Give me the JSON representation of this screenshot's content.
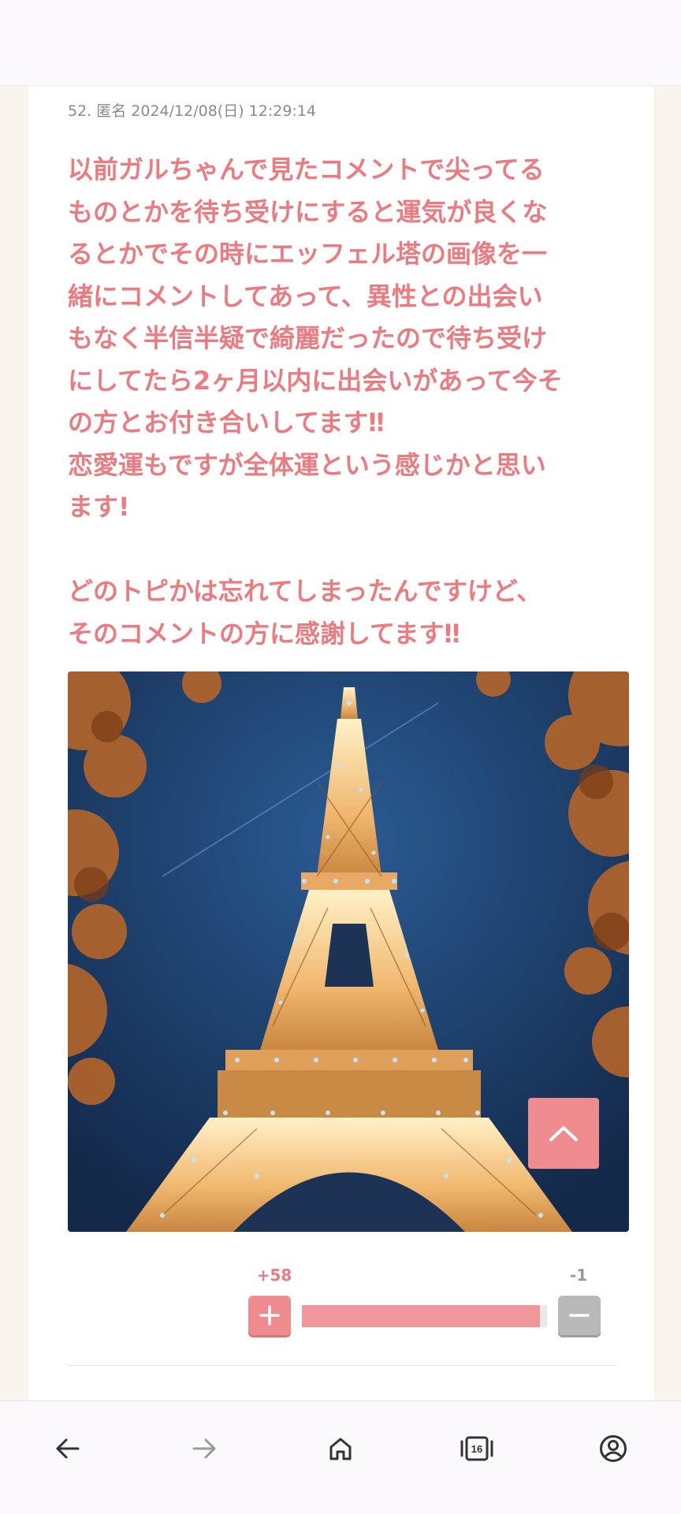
{
  "post": {
    "header": "52. 匿名 2024/12/08(日) 12:29:14",
    "body": "以前ガルちゃんで見たコメントで尖ってる\nものとかを待ち受けにすると運気が良くな\nるとかでその時にエッフェル塔の画像を一\n緒にコメントしてあって、異性との出会い\nもなく半信半疑で綺麗だったので待ち受け\nにしてたら2ヶ月以内に出会いがあって今そ\nの方とお付き合いしてます‼︎\n恋愛運もですが全体運という感じかと思い\nます!\n\nどのトピかは忘れてしまったんですけど、\nそのコメントの方に感謝してます‼︎",
    "image_alt": "エッフェル塔"
  },
  "votes": {
    "plus_label": "+58",
    "minus_label": "-1",
    "plus_fraction": 0.97
  },
  "colors": {
    "accent": "#ec7b80",
    "accent_button": "#ef8c8f",
    "minus_gray": "#b9b9b9",
    "page_bg": "#faf4ee"
  },
  "icons": {
    "scroll_top": "chevron-up-icon",
    "vote_plus": "plus-icon",
    "vote_minus": "minus-icon",
    "nav": [
      "back-arrow-icon",
      "forward-arrow-icon",
      "home-icon",
      "tabs-icon",
      "account-icon"
    ]
  },
  "bottom_nav": {
    "tab_count": "16"
  }
}
